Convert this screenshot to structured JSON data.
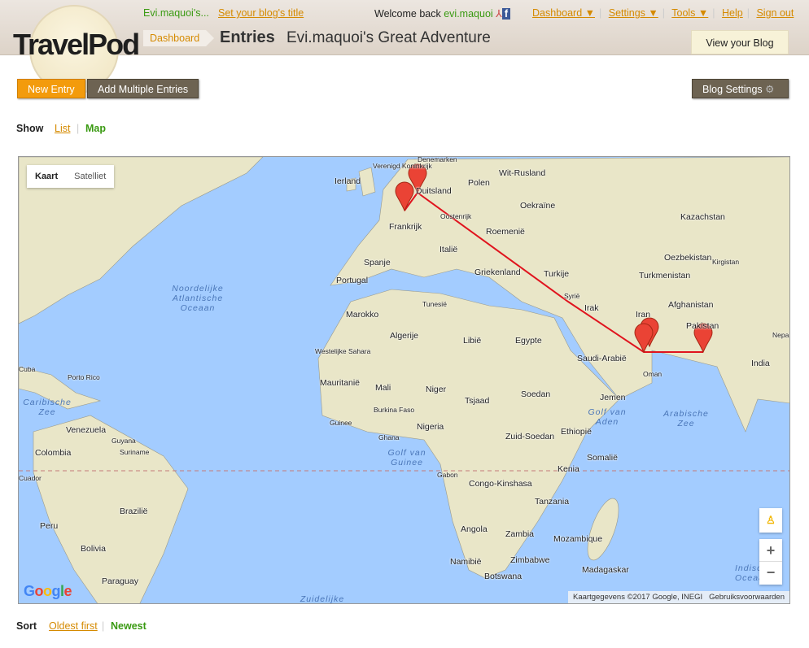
{
  "header": {
    "logo_text": "TravelPod",
    "user_short": "Evi.maquoi's...",
    "set_title_link": "Set your blog's title",
    "welcome": "Welcome back",
    "username": "evi.maquoi",
    "nav": [
      "Dashboard ▼",
      "Settings ▼",
      "Tools ▼",
      "Help",
      "Sign out"
    ],
    "breadcrumb": "Dashboard",
    "page_title": "Entries",
    "blog_title": "Evi.maquoi's Great Adventure",
    "view_blog": "View your Blog"
  },
  "toolbar": {
    "new_entry": "New Entry",
    "add_multiple": "Add Multiple Entries",
    "blog_settings": "Blog Settings"
  },
  "show": {
    "label": "Show",
    "list": "List",
    "map": "Map"
  },
  "map": {
    "types": [
      "Kaart",
      "Satelliet"
    ],
    "zoom_in": "+",
    "zoom_out": "−",
    "attribution": "Kaartgegevens ©2017 Google, INEGI",
    "terms": "Gebruiksvoorwaarden",
    "google_logo": "Google",
    "labels": [
      "Verenigd Koninkrijk",
      "Denemarken",
      "Ierland",
      "Duitsland",
      "Polen",
      "Wit-Rusland",
      "Oekraïne",
      "Frankrijk",
      "Oostenrijk",
      "Roemenië",
      "Kazachstan",
      "Spanje",
      "Italië",
      "Oezbekistan",
      "Kirgistan",
      "Portugal",
      "Turkije",
      "Griekenland",
      "Turkmenistan",
      "Syrië",
      "Afghanistan",
      "Irak",
      "Iran",
      "Pakistan",
      "Marokko",
      "Tunesië",
      "Algerije",
      "Libië",
      "Egypte",
      "Saudi-Arabië",
      "Nepal",
      "Westelijke Sahara",
      "India",
      "Oman",
      "Cuba",
      "Porto Rico",
      "Mauritanië",
      "Mali",
      "Niger",
      "Tsjaad",
      "Soedan",
      "Jemen",
      "Burkina Faso",
      "Guinee",
      "Nigeria",
      "Ghana",
      "Zuid-Soedan",
      "Ethiopië",
      "Venezuela",
      "Guyana",
      "Suriname",
      "Colombia",
      "Somalië",
      "Kenia",
      "Gabon",
      "Congo-Kinshasa",
      "Tanzania",
      "Brazilië",
      "Peru",
      "Angola",
      "Zambia",
      "Mozambique",
      "Bolivia",
      "Namibië",
      "Zimbabwe",
      "Madagaskar",
      "Botswana",
      "Paraguay",
      "Cuador"
    ],
    "seas": [
      "Noordelijke Atlantische Oceaan",
      "Caribische Zee",
      "Golf van Aden",
      "Arabische Zee",
      "Golf van Guinee",
      "Zuidelijke",
      "Indische Oceaan"
    ],
    "route_color": "#e0141e"
  },
  "sort": {
    "label": "Sort",
    "oldest": "Oldest first",
    "newest": "Newest"
  }
}
